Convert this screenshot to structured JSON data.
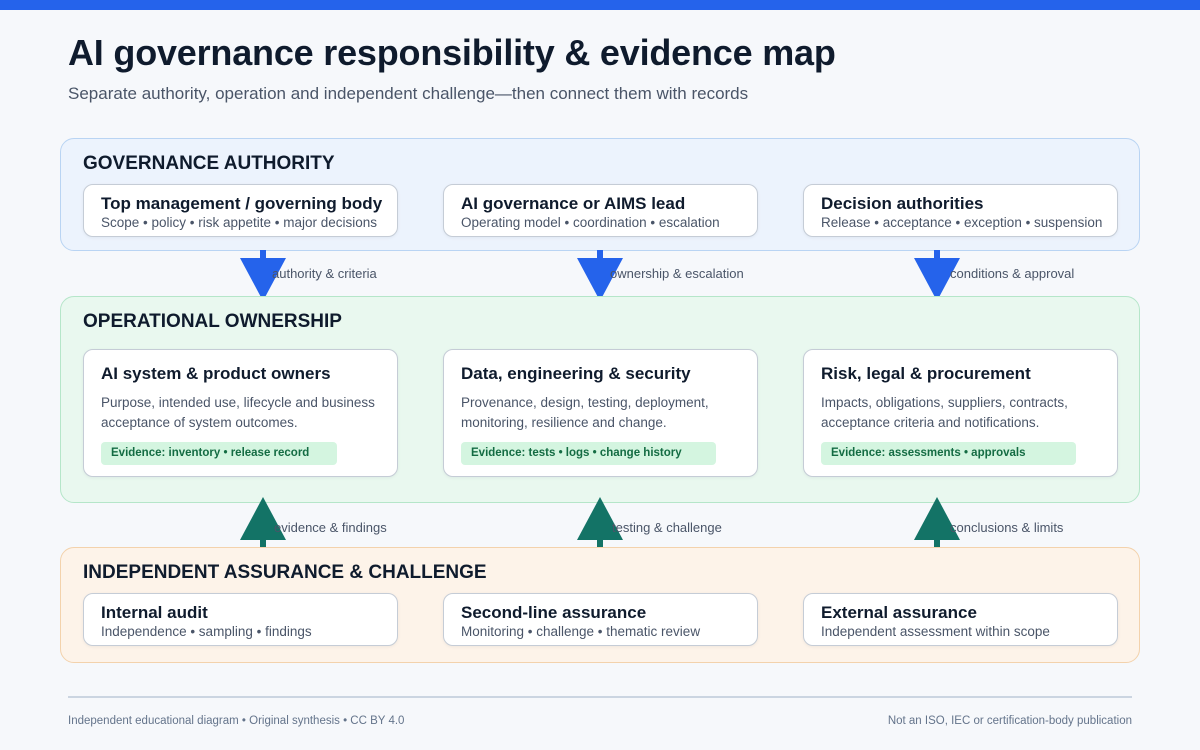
{
  "header": {
    "title": "AI governance responsibility & evidence map",
    "subtitle": "Separate authority, operation and independent challenge—then connect them with records"
  },
  "colors": {
    "accent": "#2563eb",
    "down_arrow": "#2563eb",
    "up_arrow": "#137366",
    "evidence_bg": "#d4f5e0",
    "evidence_text": "#146c43"
  },
  "governance": {
    "title": "GOVERNANCE AUTHORITY",
    "cards": [
      {
        "title": "Top management / governing body",
        "subtitle": "Scope • policy • risk appetite • major decisions"
      },
      {
        "title": "AI governance or AIMS lead",
        "subtitle": "Operating model • coordination • escalation"
      },
      {
        "title": "Decision authorities",
        "subtitle": "Release • acceptance • exception • suspension"
      }
    ]
  },
  "down_connectors": [
    {
      "label": "authority & criteria",
      "icon": "arrow-down-icon"
    },
    {
      "label": "ownership & escalation",
      "icon": "arrow-down-icon"
    },
    {
      "label": "conditions & approval",
      "icon": "arrow-down-icon"
    }
  ],
  "operations": {
    "title": "OPERATIONAL OWNERSHIP",
    "cards": [
      {
        "title": "AI system & product owners",
        "description": "Purpose, intended use, lifecycle and business acceptance of system outcomes.",
        "evidence": "Evidence: inventory • release record"
      },
      {
        "title": "Data, engineering & security",
        "description": "Provenance, design, testing, deployment, monitoring, resilience and change.",
        "evidence": "Evidence: tests • logs • change history"
      },
      {
        "title": "Risk, legal & procurement",
        "description": "Impacts, obligations, suppliers, contracts, acceptance criteria and notifications.",
        "evidence": "Evidence: assessments • approvals"
      }
    ]
  },
  "up_connectors": [
    {
      "label": "evidence & findings",
      "icon": "arrow-up-icon"
    },
    {
      "label": "testing & challenge",
      "icon": "arrow-up-icon"
    },
    {
      "label": "conclusions & limits",
      "icon": "arrow-up-icon"
    }
  ],
  "assurance": {
    "title": "INDEPENDENT ASSURANCE & CHALLENGE",
    "cards": [
      {
        "title": "Internal audit",
        "subtitle": "Independence • sampling • findings"
      },
      {
        "title": "Second-line assurance",
        "subtitle": "Monitoring • challenge • thematic review"
      },
      {
        "title": "External assurance",
        "subtitle": "Independent assessment within scope"
      }
    ]
  },
  "footer": {
    "left": "Independent educational diagram • Original synthesis • CC BY 4.0",
    "right": "Not an ISO, IEC or certification-body publication"
  }
}
